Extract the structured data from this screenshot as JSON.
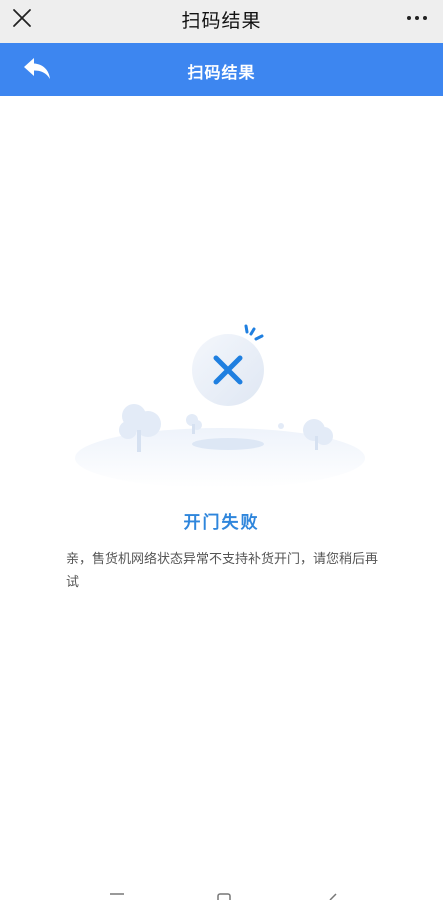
{
  "top_bar": {
    "title": "扫码结果",
    "close_icon": "close-icon",
    "more_icon": "more-icon"
  },
  "header": {
    "title": "扫码结果",
    "back_icon": "back-arrow-icon",
    "color": "#3d86f0"
  },
  "result": {
    "status_icon": "x-circle-icon",
    "title": "开门失败",
    "message": "亲，售货机网络状态异常不支持补货开门，请您稍后再试",
    "accent": "#2f86dc"
  }
}
